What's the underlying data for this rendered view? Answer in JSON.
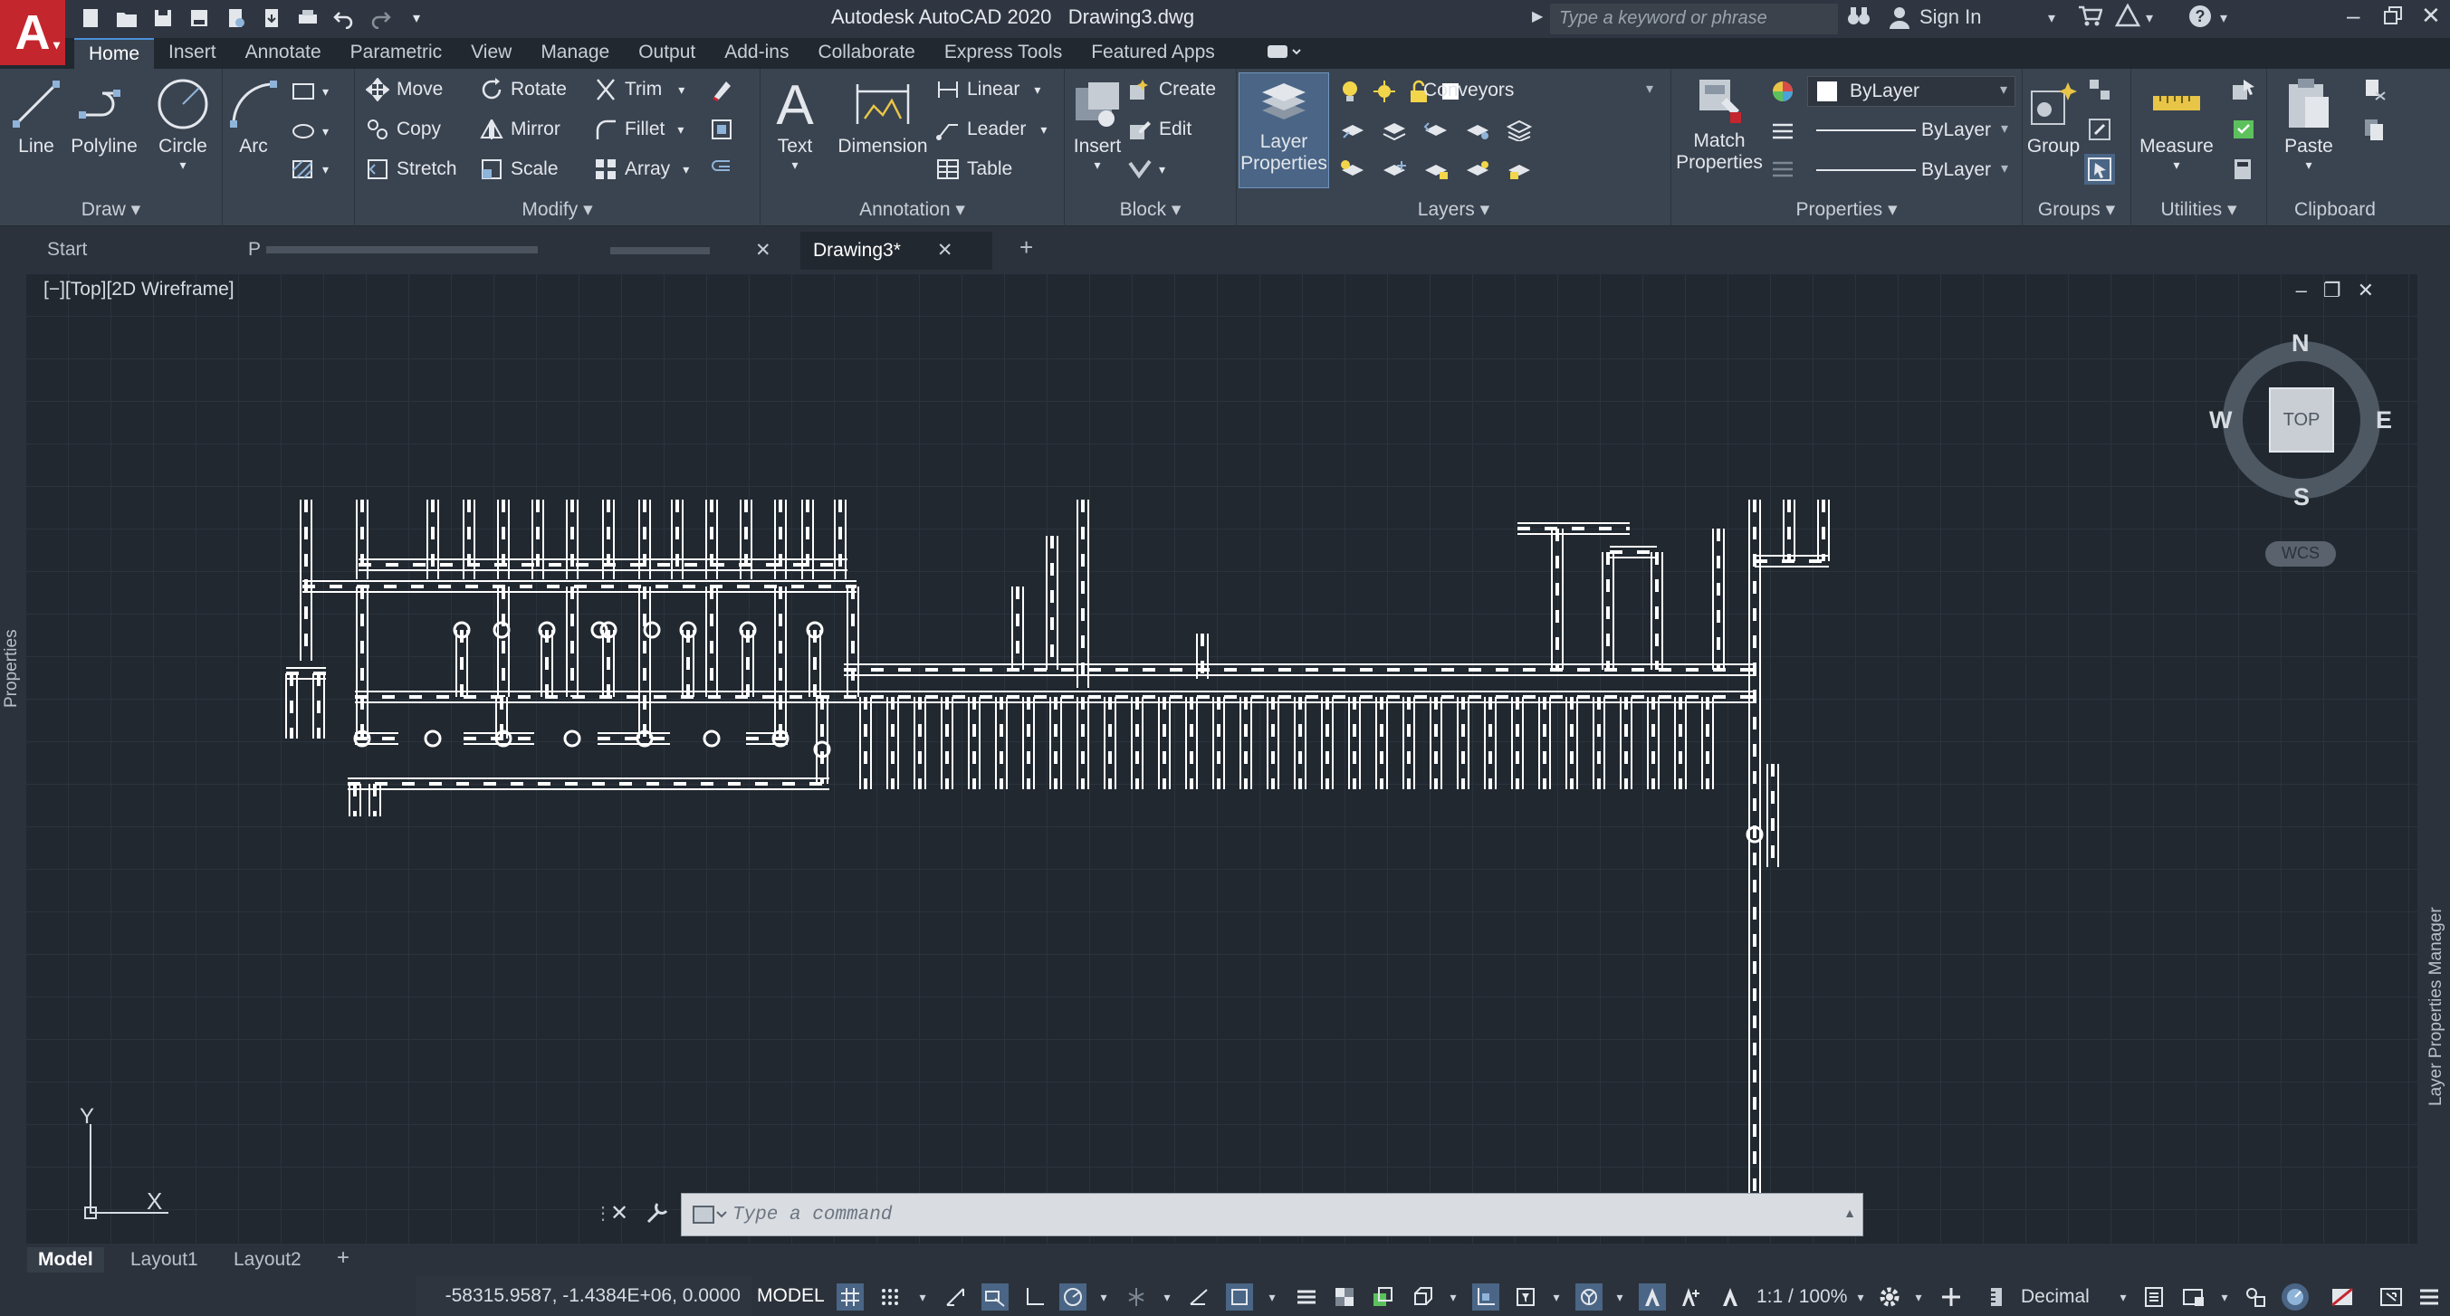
{
  "title": {
    "app": "Autodesk AutoCAD 2020",
    "file": "Drawing3.dwg",
    "search_placeholder": "Type a keyword or phrase",
    "sign_in": "Sign In"
  },
  "app_logo": "A",
  "ribbon_tabs": [
    "Home",
    "Insert",
    "Annotate",
    "Parametric",
    "View",
    "Manage",
    "Output",
    "Add-ins",
    "Collaborate",
    "Express Tools",
    "Featured Apps"
  ],
  "active_ribbon_tab": "Home",
  "ribbon": {
    "draw": {
      "title": "Draw",
      "line": "Line",
      "polyline": "Polyline",
      "circle": "Circle",
      "arc": "Arc"
    },
    "modify": {
      "title": "Modify",
      "move": "Move",
      "rotate": "Rotate",
      "trim": "Trim",
      "copy": "Copy",
      "mirror": "Mirror",
      "fillet": "Fillet",
      "stretch": "Stretch",
      "scale": "Scale",
      "array": "Array"
    },
    "annotation": {
      "title": "Annotation",
      "text": "Text",
      "dimension": "Dimension",
      "linear": "Linear",
      "leader": "Leader",
      "table": "Table"
    },
    "block": {
      "title": "Block",
      "insert": "Insert",
      "create": "Create",
      "edit": "Edit"
    },
    "layers": {
      "title": "Layers",
      "layer_properties_line1": "Layer",
      "layer_properties_line2": "Properties",
      "current_layer": "Conveyors"
    },
    "properties": {
      "title": "Properties",
      "match_line1": "Match",
      "match_line2": "Properties",
      "color": "ByLayer",
      "linetype": "ByLayer",
      "lineweight": "ByLayer"
    },
    "groups": {
      "title": "Groups",
      "group": "Group"
    },
    "utilities": {
      "title": "Utilities",
      "measure": "Measure"
    },
    "clipboard": {
      "title": "Clipboard",
      "paste": "Paste"
    }
  },
  "file_tabs": [
    {
      "label": "Start",
      "active": false
    },
    {
      "label": "P",
      "active": false
    },
    {
      "label": "",
      "active": false
    },
    {
      "label": "Drawing3*",
      "active": true
    }
  ],
  "viewport": {
    "label": "[−][Top][2D Wireframe]",
    "viewcube": {
      "n": "N",
      "s": "S",
      "e": "E",
      "w": "W",
      "face": "TOP"
    },
    "wcs": "WCS",
    "ucs_x": "X",
    "ucs_y": "Y"
  },
  "side_palettes": {
    "left": "Properties",
    "right": "Layer Properties Manager"
  },
  "command_line": {
    "placeholder": "Type a command"
  },
  "layout_tabs": [
    {
      "label": "Model",
      "active": true
    },
    {
      "label": "Layout1",
      "active": false
    },
    {
      "label": "Layout2",
      "active": false
    }
  ],
  "status_bar": {
    "coordinates": "-58315.9587, -1.4384E+06, 0.0000",
    "space": "MODEL",
    "annotation_scale": "1:1 / 100%",
    "units": "Decimal"
  },
  "colors": {
    "accent": "#4a90d9",
    "background": "#212830",
    "ribbon": "#3a4350",
    "logo": "#c4262e",
    "geometry": "#ffffff"
  }
}
